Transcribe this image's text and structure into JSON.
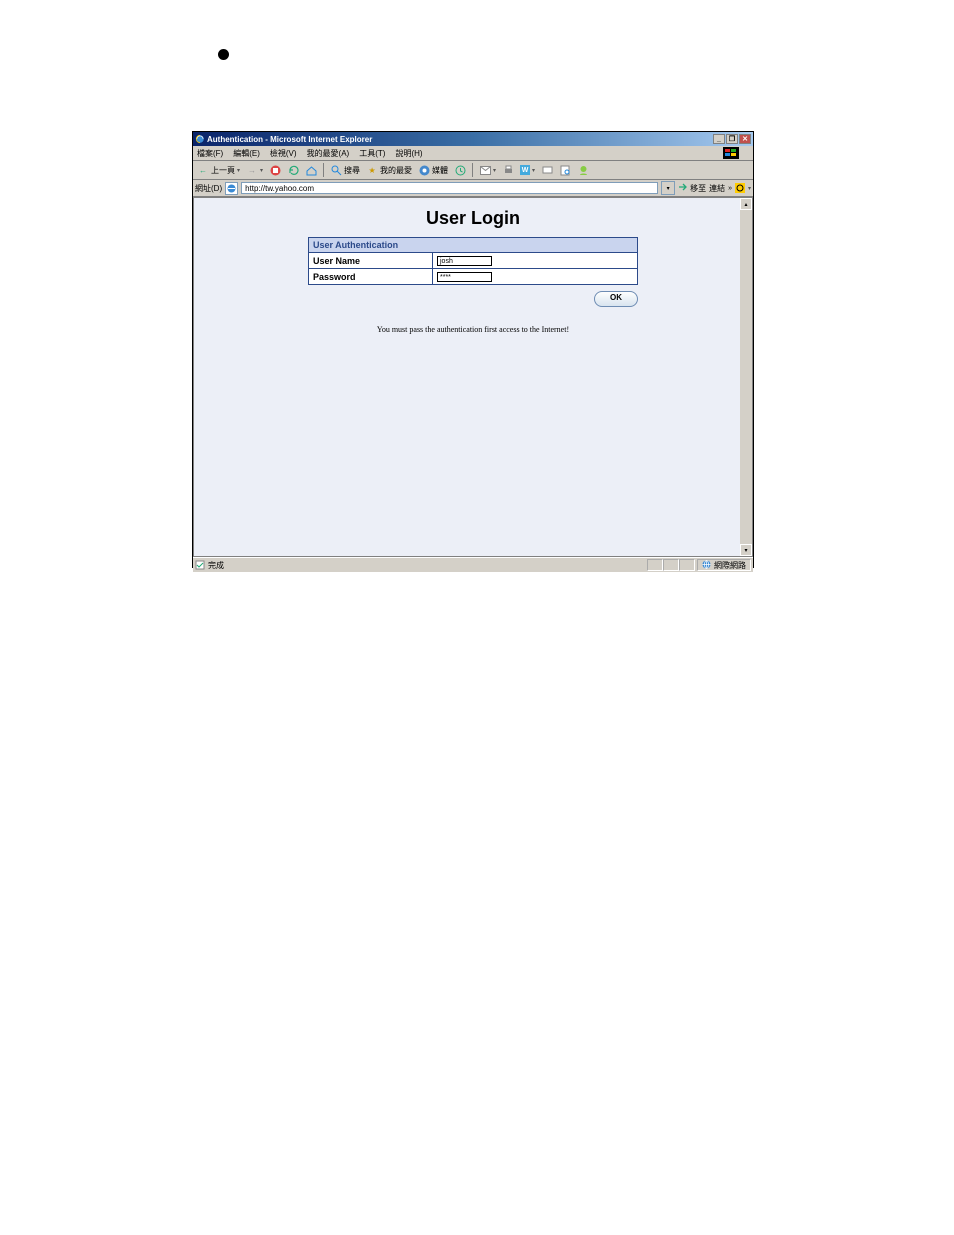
{
  "titlebar": {
    "title": "Authentication - Microsoft Internet Explorer"
  },
  "menu": {
    "file": "檔案(F)",
    "edit": "編輯(E)",
    "view": "檢視(V)",
    "favorites": "我的最愛(A)",
    "tools": "工具(T)",
    "help": "說明(H)"
  },
  "toolbar": {
    "back": "上一頁",
    "search": "搜尋",
    "favorites": "我的最愛",
    "media": "媒體"
  },
  "address": {
    "label": "網址(D)",
    "url": "http://tw.yahoo.com",
    "go": "移至",
    "links": "連結"
  },
  "page": {
    "heading": "User Login",
    "auth_header": "User Authentication",
    "username_label": "User Name",
    "username_value": "josh",
    "password_label": "Password",
    "password_value": "****",
    "ok_label": "OK",
    "note": "You must pass the authentication first access to the Internet!"
  },
  "status": {
    "done": "完成",
    "zone": "網際網路"
  }
}
